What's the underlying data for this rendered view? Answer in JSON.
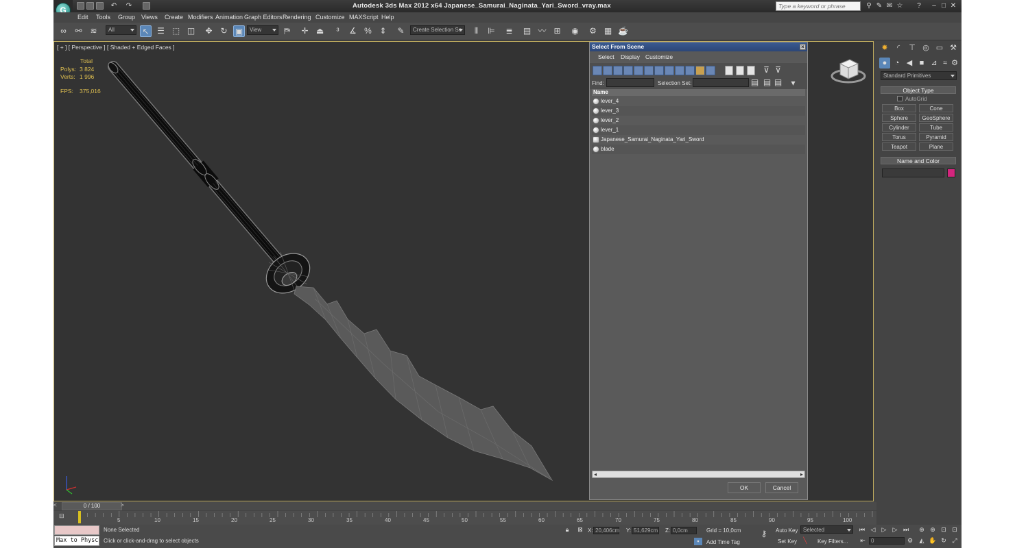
{
  "window": {
    "title": "Autodesk 3ds Max  2012 x64     Japanese_Samurai_Naginata_Yari_Sword_vray.max",
    "search_placeholder": "Type a keyword or phrase"
  },
  "menu": [
    "Edit",
    "Tools",
    "Group",
    "Views",
    "Create",
    "Modifiers",
    "Animation",
    "Graph Editors",
    "Rendering",
    "Customize",
    "MAXScript",
    "Help"
  ],
  "toolbar": {
    "filter": "All",
    "ref_coord": "View",
    "selection_set": "Create Selection Se"
  },
  "viewport": {
    "label": "[ + ] [ Perspective ] [ Shaded + Edged Faces ]",
    "stats_header": "Total",
    "polys_label": "Polys:",
    "polys": "3 824",
    "verts_label": "Verts:",
    "verts": "1 996",
    "fps_label": "FPS:",
    "fps": "375,016"
  },
  "dialog": {
    "title": "Select From Scene",
    "menu": [
      "Select",
      "Display",
      "Customize"
    ],
    "find_label": "Find:",
    "selset_label": "Selection Set:",
    "column": "Name",
    "items": [
      "lever_4",
      "lever_3",
      "lever_2",
      "lever_1",
      "Japanese_Samurai_Naginata_Yari_Sword",
      "blade"
    ],
    "ok": "OK",
    "cancel": "Cancel"
  },
  "command_panel": {
    "category": "Standard Primitives",
    "object_type": "Object Type",
    "autogrid": "AutoGrid",
    "buttons": [
      "Box",
      "Cone",
      "Sphere",
      "GeoSphere",
      "Cylinder",
      "Tube",
      "Torus",
      "Pyramid",
      "Teapot",
      "Plane"
    ],
    "name_color": "Name and Color",
    "color": "#d4257e"
  },
  "timeline": {
    "frame": "0 / 100",
    "ticks": [
      "5",
      "10",
      "15",
      "20",
      "25",
      "30",
      "35",
      "40",
      "45",
      "50",
      "55",
      "60",
      "65",
      "70",
      "75",
      "80",
      "85",
      "90",
      "95",
      "100"
    ]
  },
  "status": {
    "maxscript": "Max to Physc",
    "selection": "None Selected",
    "prompt": "Click or click-and-drag to select objects",
    "x_label": "X:",
    "x": "20,406cm",
    "y_label": "Y:",
    "y": "51,629cm",
    "z_label": "Z:",
    "z": "0,0cm",
    "grid": "Grid = 10,0cm",
    "add_time_tag": "Add Time Tag",
    "auto_key": "Auto Key",
    "set_key": "Set Key",
    "key_mode": "Selected",
    "key_filters": "Key Filters...",
    "frame_field": "0"
  }
}
